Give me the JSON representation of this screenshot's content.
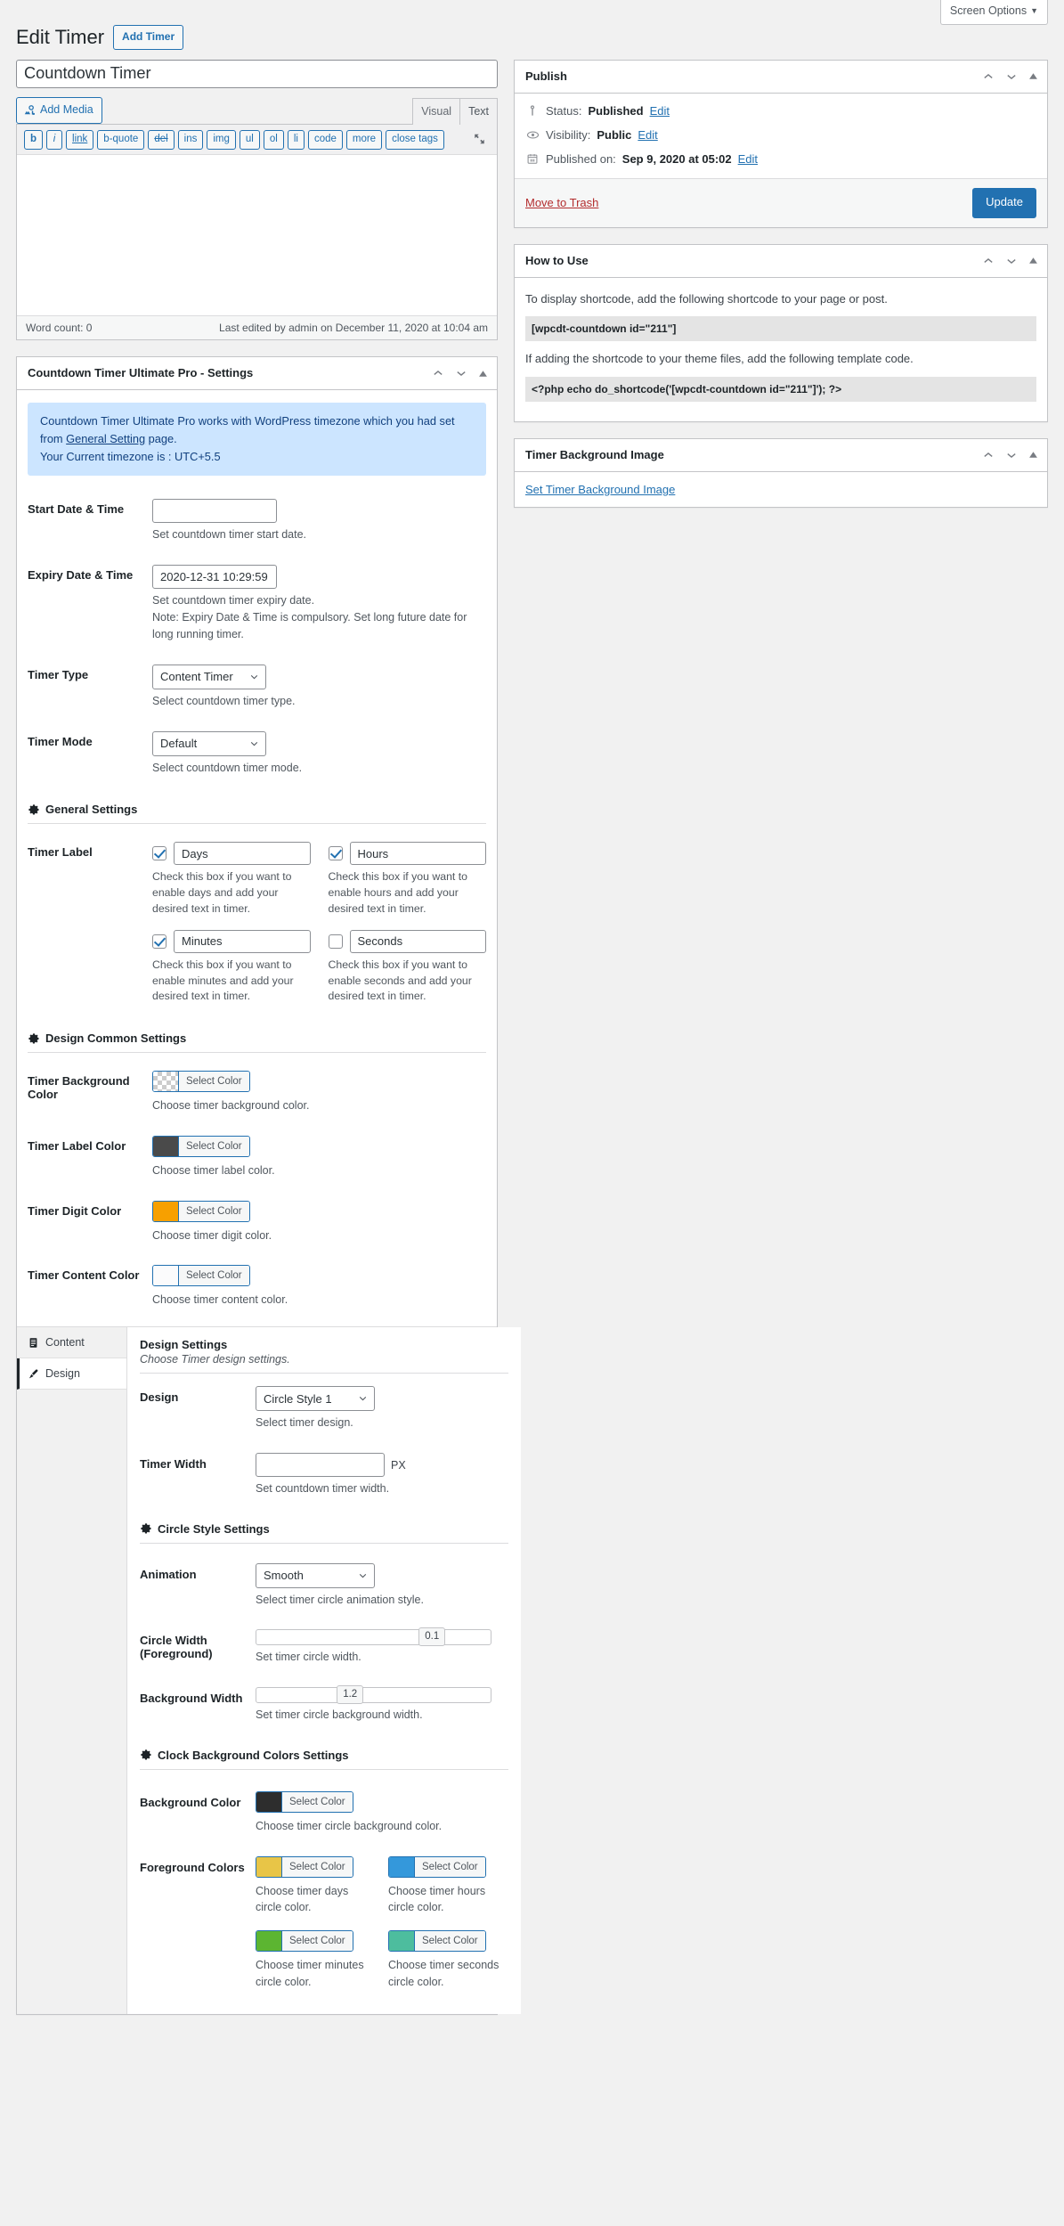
{
  "screen_options": {
    "label": "Screen Options",
    "caret": "▼"
  },
  "header": {
    "title": "Edit Timer",
    "add_button": "Add Timer"
  },
  "title_field": {
    "value": "Countdown Timer"
  },
  "editor": {
    "add_media": "Add Media",
    "tabs": {
      "visual": "Visual",
      "text": "Text"
    },
    "quicktags": [
      "b",
      "i",
      "link",
      "b-quote",
      "del",
      "ins",
      "img",
      "ul",
      "ol",
      "li",
      "code",
      "more",
      "close tags"
    ],
    "word_count": "Word count: 0",
    "last_edited": "Last edited by admin on December 11, 2020 at 10:04 am"
  },
  "publish": {
    "title": "Publish",
    "status_label": "Status:",
    "status_value": "Published",
    "status_edit": "Edit",
    "visibility_label": "Visibility:",
    "visibility_value": "Public",
    "visibility_edit": "Edit",
    "published_label": "Published on:",
    "published_value": "Sep 9, 2020 at 05:02",
    "published_edit": "Edit",
    "trash": "Move to Trash",
    "update": "Update"
  },
  "howto": {
    "title": "How to Use",
    "p1": "To display shortcode, add the following shortcode to your page or post.",
    "code1": "[wpcdt-countdown id=\"211\"]",
    "p2": "If adding the shortcode to your theme files, add the following template code.",
    "code2": "<?php echo do_shortcode('[wpcdt-countdown id=\"211\"]'); ?>"
  },
  "bgimage": {
    "title": "Timer Background Image",
    "link": "Set Timer Background Image"
  },
  "settings": {
    "title": "Countdown Timer Ultimate Pro - Settings",
    "notice_line1_a": "Countdown Timer Ultimate Pro works with WordPress timezone which you had set from ",
    "notice_link": "General Setting",
    "notice_line1_b": " page.",
    "notice_line2": "Your Current timezone is : UTC+5.5",
    "start_date": {
      "label": "Start Date & Time",
      "value": "",
      "desc": "Set countdown timer start date."
    },
    "expiry_date": {
      "label": "Expiry Date & Time",
      "value": "2020-12-31 10:29:59",
      "desc": "Set countdown timer expiry date.",
      "note": "Note: Expiry Date & Time is compulsory. Set long future date for long running timer."
    },
    "timer_type": {
      "label": "Timer Type",
      "value": "Content Timer",
      "desc": "Select countdown timer type."
    },
    "timer_mode": {
      "label": "Timer Mode",
      "value": "Default",
      "desc": "Select countdown timer mode."
    },
    "general_section": "General Settings",
    "timer_label": {
      "label": "Timer Label",
      "items": [
        {
          "checked": true,
          "value": "Days",
          "desc": "Check this box if you want to enable days and add your desired text in timer."
        },
        {
          "checked": true,
          "value": "Hours",
          "desc": "Check this box if you want to enable hours and add your desired text in timer."
        },
        {
          "checked": true,
          "value": "Minutes",
          "desc": "Check this box if you want to enable minutes and add your desired text in timer."
        },
        {
          "checked": false,
          "value": "Seconds",
          "desc": "Check this box if you want to enable seconds and add your desired text in timer."
        }
      ]
    },
    "design_common_section": "Design Common Settings",
    "select_color_label": "Select Color",
    "common_colors": [
      {
        "label": "Timer Background Color",
        "desc": "Choose timer background color.",
        "color": "transparent"
      },
      {
        "label": "Timer Label Color",
        "desc": "Choose timer label color.",
        "color": "#4a4a4a"
      },
      {
        "label": "Timer Digit Color",
        "desc": "Choose timer digit color.",
        "color": "#f7a000"
      },
      {
        "label": "Timer Content Color",
        "desc": "Choose timer content color.",
        "color": "#fbfbfc"
      }
    ]
  },
  "design_tabs": {
    "rail": [
      {
        "label": "Content",
        "icon": "content-icon",
        "active": false
      },
      {
        "label": "Design",
        "icon": "brush-icon",
        "active": true
      }
    ],
    "heading": "Design Settings",
    "sub": "Choose Timer design settings.",
    "design": {
      "label": "Design",
      "value": "Circle Style 1",
      "desc": "Select timer design."
    },
    "timer_width": {
      "label": "Timer Width",
      "value": "",
      "unit": "PX",
      "desc": "Set countdown timer width."
    },
    "circle_section": "Circle Style Settings",
    "animation": {
      "label": "Animation",
      "value": "Smooth",
      "desc": "Select timer circle animation style."
    },
    "circle_width": {
      "label": "Circle Width (Foreground)",
      "value": "0.1",
      "percent": 75,
      "desc": "Set timer circle width."
    },
    "background_width": {
      "label": "Background Width",
      "value": "1.2",
      "percent": 40,
      "desc": "Set timer circle background width."
    },
    "clock_section": "Clock Background Colors Settings",
    "select_color_label": "Select Color",
    "background_color": {
      "label": "Background Color",
      "desc": "Choose timer circle background color.",
      "color": "#2d2d2d"
    },
    "foreground_colors": {
      "label": "Foreground Colors",
      "items": [
        {
          "desc": "Choose timer days circle color.",
          "color": "#e8c547"
        },
        {
          "desc": "Choose timer hours circle color.",
          "color": "#3498db"
        },
        {
          "desc": "Choose timer minutes circle color.",
          "color": "#5cb531"
        },
        {
          "desc": "Choose timer seconds circle color.",
          "color": "#4dbd9e"
        }
      ]
    }
  }
}
